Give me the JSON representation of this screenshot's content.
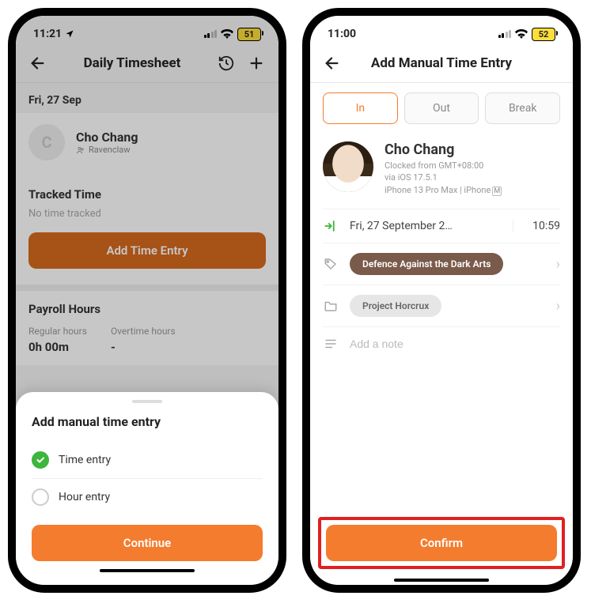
{
  "left": {
    "status": {
      "time": "11:21",
      "battery": "51"
    },
    "header": {
      "title": "Daily Timesheet"
    },
    "date_label": "Fri, 27 Sep",
    "user": {
      "initial": "C",
      "name": "Cho Chang",
      "house": "Ravenclaw"
    },
    "tracked": {
      "title": "Tracked Time",
      "empty_text": "No time tracked",
      "add_btn": "Add Time Entry"
    },
    "payroll": {
      "title": "Payroll Hours",
      "cols": [
        {
          "label": "Regular hours",
          "value": "0h 00m"
        },
        {
          "label": "Overtime hours",
          "value": "-"
        }
      ]
    },
    "sheet": {
      "title": "Add manual time entry",
      "opt1": "Time entry",
      "opt2": "Hour entry",
      "continue_btn": "Continue"
    }
  },
  "right": {
    "status": {
      "time": "11:00",
      "battery": "52"
    },
    "header": {
      "title": "Add Manual Time Entry"
    },
    "segments": {
      "in": "In",
      "out": "Out",
      "break": "Break"
    },
    "profile": {
      "name": "Cho Chang",
      "line1": "Clocked from GMT+08:00",
      "line2": "via iOS 17.5.1",
      "line3": "iPhone 13 Pro Max | iPhone"
    },
    "date_row": {
      "date": "Fri, 27 September 2…",
      "time": "10:59"
    },
    "tag": "Defence Against the Dark Arts",
    "project": "Project Horcrux",
    "note_placeholder": "Add a note",
    "confirm_btn": "Confirm"
  }
}
